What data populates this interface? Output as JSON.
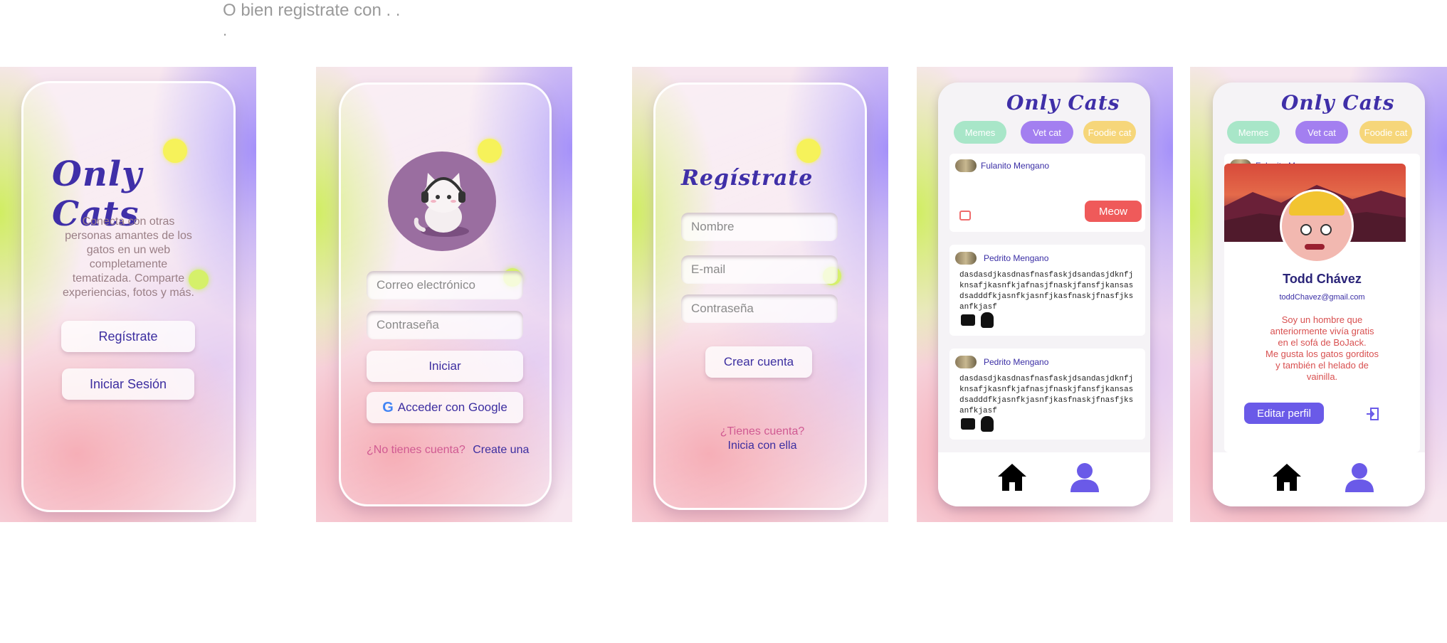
{
  "header": {
    "line1": "O bien registrate con . .",
    "line2": "."
  },
  "splash": {
    "logo": "Only Cats",
    "description": "Conecta con otras personas amantes de los gatos en un web completamente tematizada. Comparte experiencias, fotos y más.",
    "register_label": "Regístrate",
    "login_label": "Iniciar Sesión"
  },
  "login": {
    "email_placeholder": "Correo electrónico",
    "password_placeholder": "Contraseña",
    "submit_label": "Iniciar",
    "google_label": "Acceder con Google",
    "no_account_text": "¿No tienes cuenta?",
    "create_link": "Create una"
  },
  "register": {
    "title": "Regístrate",
    "name_placeholder": "Nombre",
    "email_placeholder": "E-mail",
    "password_placeholder": "Contraseña",
    "submit_label": "Crear cuenta",
    "have_account_text": "¿Tienes cuenta?",
    "login_link": "Inicia con ella"
  },
  "feed": {
    "logo": "Only Cats",
    "chips": [
      {
        "label": "Memes",
        "color": "#a8e6c8"
      },
      {
        "label": "Vet cat",
        "color": "#a37ff0"
      },
      {
        "label": "Foodie cat",
        "color": "#f6d67a"
      }
    ],
    "composer_author": "Fulanito Mengano",
    "meow_label": "Meow",
    "posts": [
      {
        "author": "Pedrito Mengano",
        "text": "dasdasdjkasdnasfnasfaskjdsandasjdknfjknsafjkasnfkjafnasjfnaskjfansfjkansasdsadddfkjasnfkjasnfjkasfnaskjfnasfjksanfkjasf"
      },
      {
        "author": "Pedrito Mengano",
        "text": "dasdasdjkasdnasfnasfaskjdsandasjdknfjknsafjkasnfkjafnasjfnaskjfansfjkansasdsadddfkjasnfkjasnfjkasfnaskjfnasfjksanfkjasf"
      }
    ]
  },
  "profile": {
    "logo": "Only Cats",
    "chips": [
      {
        "label": "Memes",
        "color": "#a8e6c8"
      },
      {
        "label": "Vet cat",
        "color": "#a37ff0"
      },
      {
        "label": "Foodie cat",
        "color": "#f6d67a"
      }
    ],
    "behind_author": "Fulanito Mengano",
    "name": "Todd Chávez",
    "email": "toddChavez@gmail.com",
    "bio_lines": [
      "Soy un hombre que",
      "anteriormente vivía gratis",
      "en el sofá de BoJack.",
      "Me gusta los gatos gorditos",
      "y también el helado de",
      "vainilla."
    ],
    "edit_label": "Editar perfil"
  },
  "colors": {
    "accent": "#3c2ea0",
    "meow": "#ef5a5a",
    "edit": "#6a5ae8",
    "nav_home": "#000000",
    "nav_user": "#6a5ae8"
  }
}
